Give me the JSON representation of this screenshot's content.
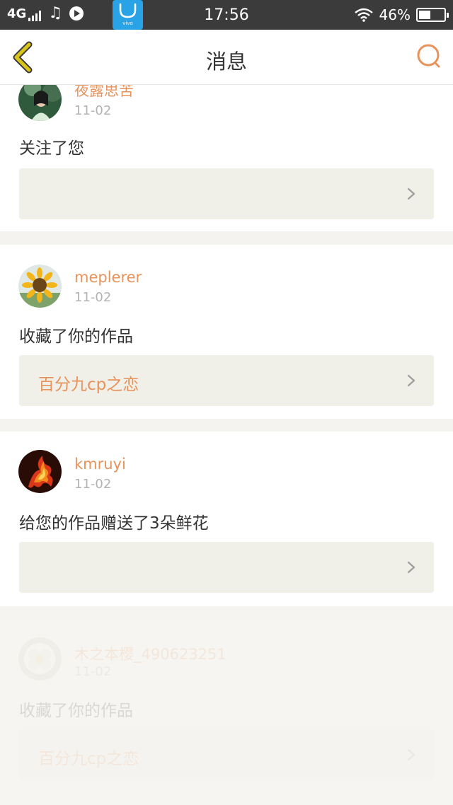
{
  "status_bar": {
    "network": "4G",
    "store_label": "vivo",
    "time": "17:56",
    "battery": "46%",
    "battery_level": 0.46
  },
  "header": {
    "title": "消息",
    "back_icon": "chevron-left-icon",
    "search_icon": "search-icon"
  },
  "colors": {
    "accent": "#e8935b",
    "back_icon": "#d9c41a",
    "card_box": "#f1f0e8"
  },
  "messages": [
    {
      "user": "夜露思苦",
      "date": "11-02",
      "action": "关注了您",
      "work_title": ""
    },
    {
      "user": "meplerer",
      "date": "11-02",
      "action": "收藏了你的作品",
      "work_title": "百分九cp之恋"
    },
    {
      "user": "kmruyi",
      "date": "11-02",
      "action": "给您的作品赠送了3朵鲜花",
      "work_title": ""
    },
    {
      "user": "木之本樱_490623251",
      "date": "11-02",
      "action": "收藏了你的作品",
      "work_title": "百分九cp之恋"
    }
  ]
}
